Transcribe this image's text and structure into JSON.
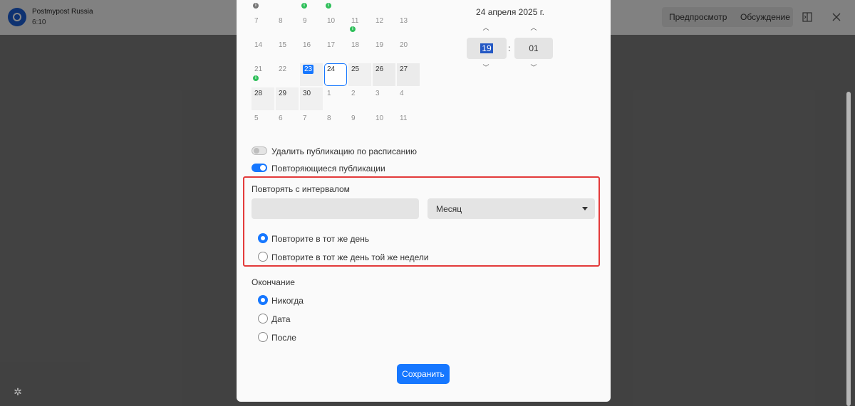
{
  "app": {
    "title": "Postmypost Russia",
    "subtitle": "6:10"
  },
  "header": {
    "tabs": [
      {
        "label": "Предпросмотр"
      },
      {
        "label": "Обсуждение"
      }
    ],
    "icons": [
      "split-view-icon",
      "close-icon"
    ]
  },
  "calendar": {
    "badges_row": [
      "i",
      "i",
      "i"
    ],
    "weeks": [
      [
        "7",
        "8",
        "9",
        "10",
        "11",
        "12",
        "13"
      ],
      [
        "14",
        "15",
        "16",
        "17",
        "18",
        "19",
        "20"
      ],
      [
        "21",
        "22",
        "23",
        "24",
        "25",
        "26",
        "27"
      ],
      [
        "28",
        "29",
        "30",
        "1",
        "2",
        "3",
        "4"
      ],
      [
        "5",
        "6",
        "7",
        "8",
        "9",
        "10",
        "11"
      ]
    ],
    "today": "23",
    "selected": "24",
    "event_badge": "i"
  },
  "datetime": {
    "date_label": "24 апреля 2025 г.",
    "hour": "19",
    "minute": "01",
    "separator": ":"
  },
  "toggles": {
    "delete_label": "Удалить публикацию по расписанию",
    "delete_on": false,
    "repeat_label": "Повторяющиеся публикации",
    "repeat_on": true
  },
  "repeat": {
    "interval_label": "Повторять с интервалом",
    "interval_value": "",
    "unit_value": "Месяц",
    "option_same_day": "Повторите в тот же день",
    "option_same_weekday": "Повторите в тот же день той же недели",
    "selected_option": "same_day"
  },
  "ending": {
    "label": "Окончание",
    "option_never": "Никогда",
    "option_date": "Дата",
    "option_after": "После",
    "selected": "never"
  },
  "save_label": "Сохранить",
  "colors": {
    "accent": "#1677ff",
    "highlight_border": "#e33a3a",
    "badge_green": "#2fbf5a"
  }
}
